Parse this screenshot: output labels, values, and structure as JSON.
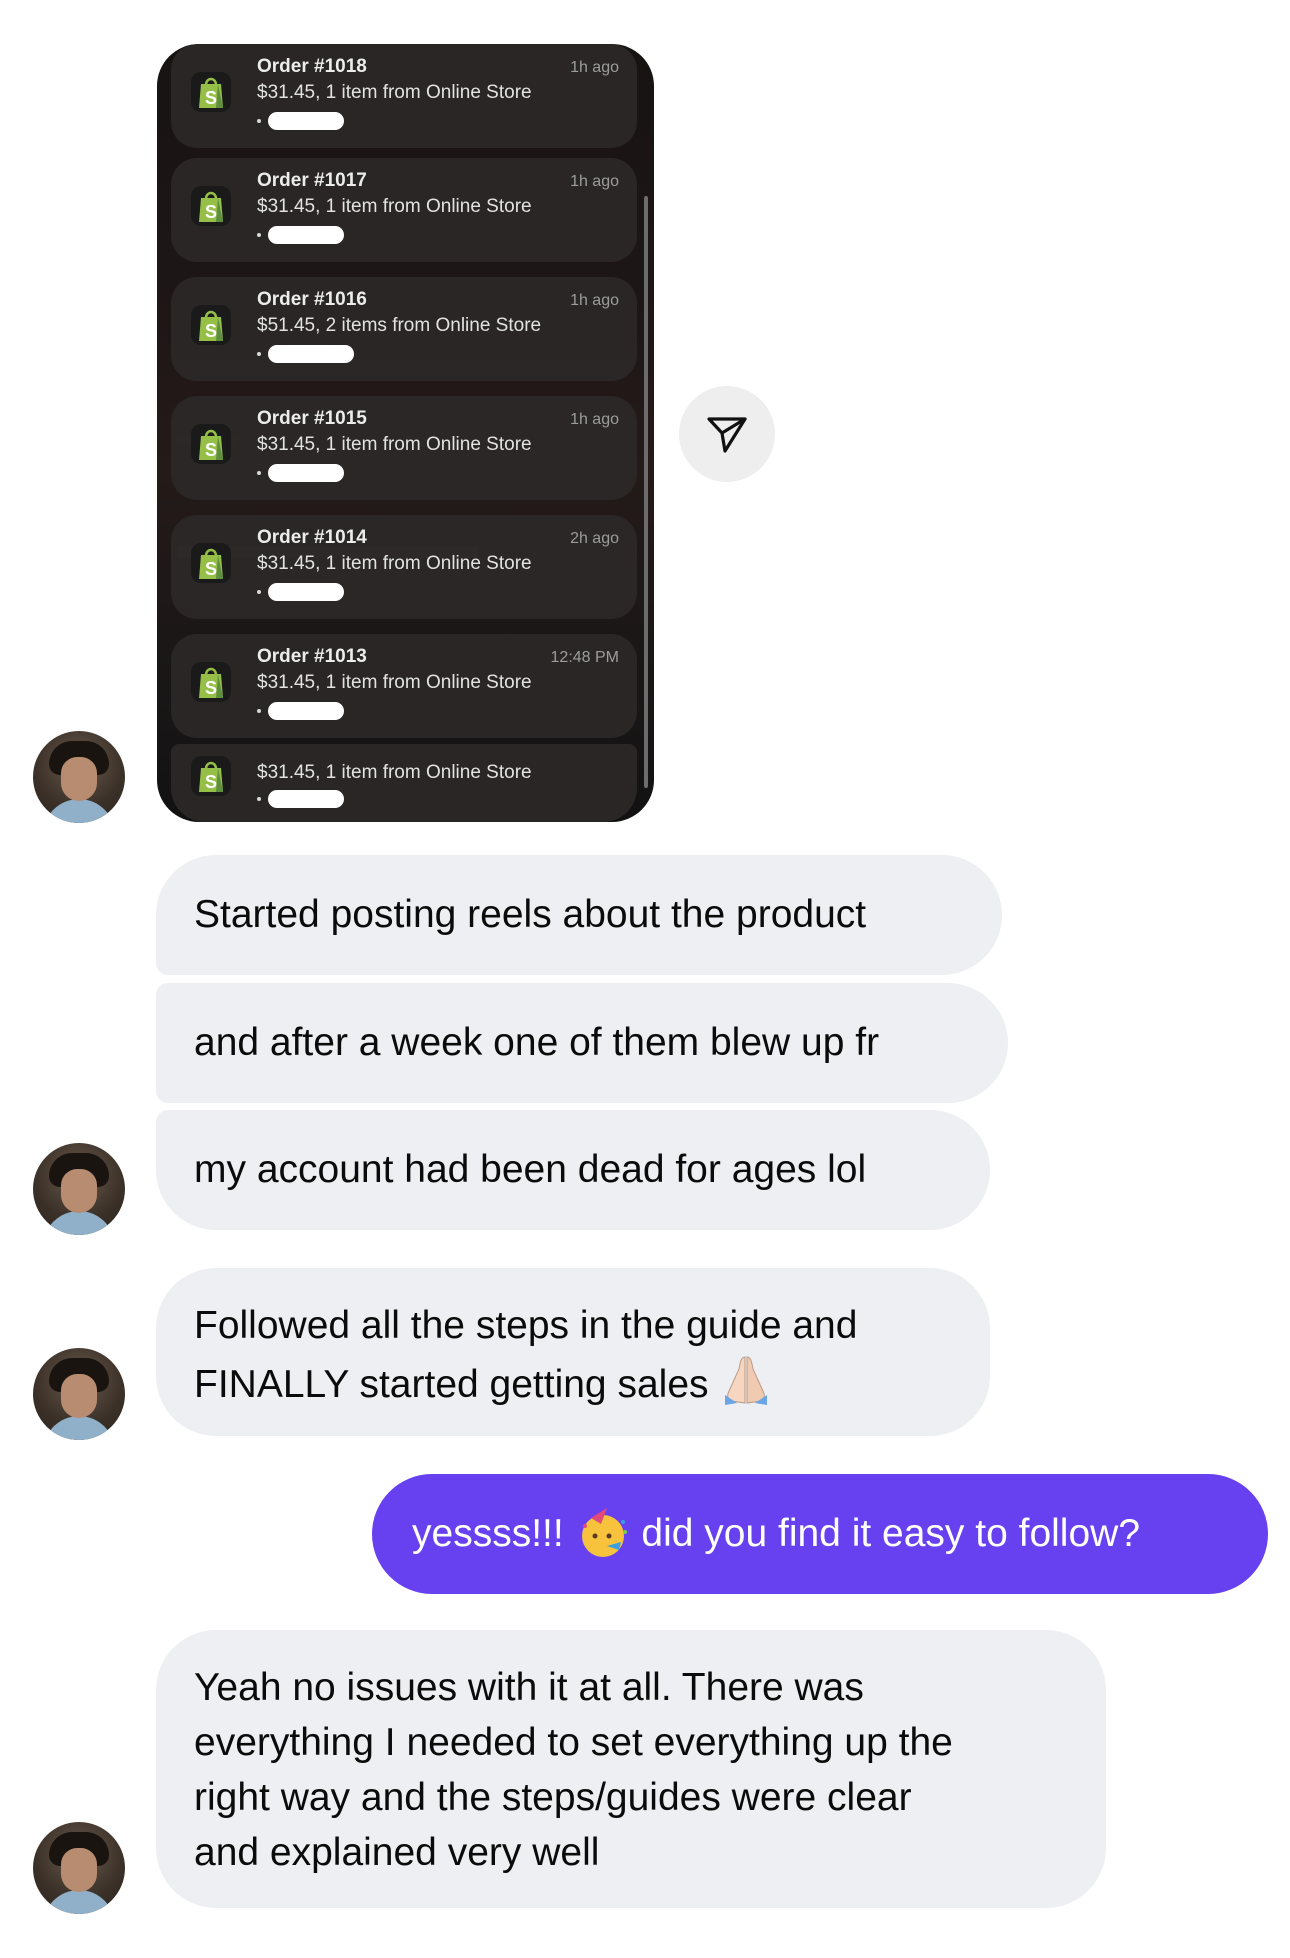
{
  "notifications": [
    {
      "title": "Order #1018",
      "body": "$31.45, 1 item from Online Store",
      "time": "1h ago"
    },
    {
      "title": "Order #1017",
      "body": "$31.45, 1 item from Online Store",
      "time": "1h ago"
    },
    {
      "title": "Order #1016",
      "body": "$51.45, 2 items from Online Store",
      "time": "1h ago"
    },
    {
      "title": "Order #1015",
      "body": "$31.45, 1 item from Online Store",
      "time": "1h ago"
    },
    {
      "title": "Order #1014",
      "body": "$31.45, 1 item from Online Store",
      "time": "2h ago"
    },
    {
      "title": "Order #1013",
      "body": "$31.45, 1 item from Online Store",
      "time": "12:48 PM"
    },
    {
      "title": "",
      "body": "$31.45, 1 item from Online Store",
      "time": ""
    }
  ],
  "messages": [
    {
      "sender": "them",
      "text": "Started posting reels about the product"
    },
    {
      "sender": "them",
      "text": "and after a week one of them blew up fr"
    },
    {
      "sender": "them",
      "text": "my account had been dead for ages lol"
    },
    {
      "sender": "them",
      "text_line1": "Followed all the steps in the guide and",
      "text_line2": "FINALLY started getting sales",
      "emoji": "🙏"
    },
    {
      "sender": "me",
      "text_before": "yessss!!!",
      "emoji": "🥳",
      "text_after": "did you find it easy to follow?"
    },
    {
      "sender": "them",
      "lines": [
        "Yeah no issues with it at all. There was",
        "everything I needed to set everything up the",
        "right way and the steps/guides were clear",
        "and explained very well"
      ]
    }
  ],
  "colors": {
    "sent_bubble": "#6740f0",
    "received_bubble": "#eeeff2",
    "shopify_green": "#95bf47"
  },
  "icons": {
    "share": "paper-plane-icon",
    "app": "shopify-bag-icon",
    "avatar": "contact-avatar"
  }
}
